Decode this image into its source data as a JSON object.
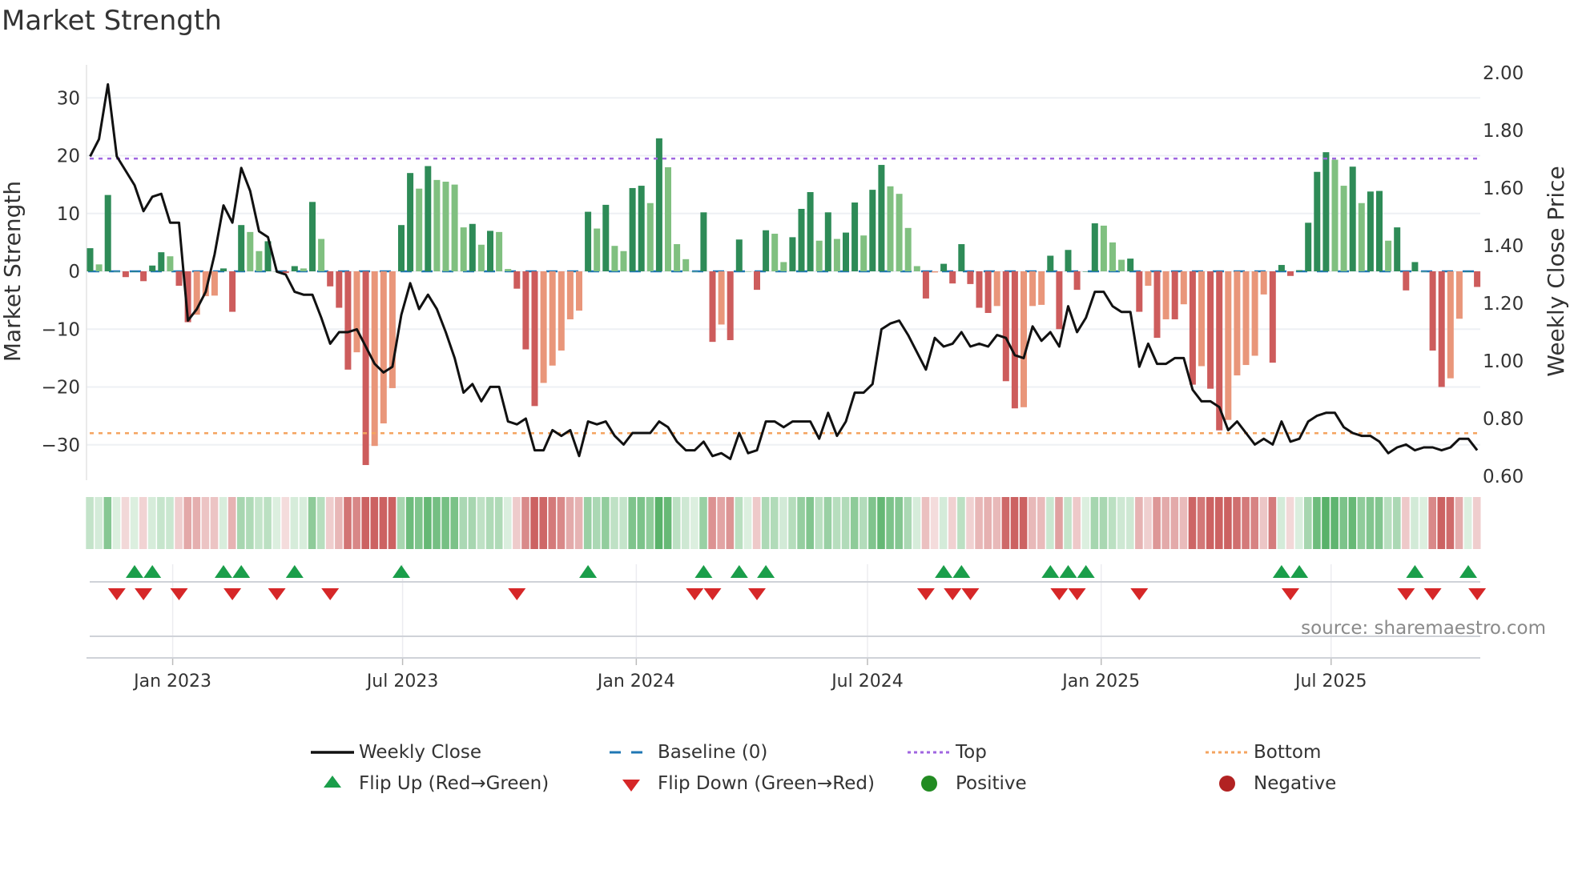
{
  "title": "Market Strength",
  "source": "source: sharemaestro.com",
  "chart_data": {
    "type": "bar+line",
    "title": "Market Strength",
    "ylabel": "Market Strength",
    "y2label": "Weekly Close Price",
    "ylim": [
      -36,
      36
    ],
    "y2lim": [
      0.586,
      2.03
    ],
    "grid": true,
    "legend_position": "bottom",
    "y_ticks": [
      {
        "value": 30,
        "label": "30"
      },
      {
        "value": 20,
        "label": "20"
      },
      {
        "value": 10,
        "label": "10"
      },
      {
        "value": 0,
        "label": "0"
      },
      {
        "value": -10,
        "label": "−10"
      },
      {
        "value": -20,
        "label": "−20"
      },
      {
        "value": -30,
        "label": "−30"
      }
    ],
    "y2_ticks": [
      {
        "value": 2.0,
        "label": "2.00"
      },
      {
        "value": 1.8,
        "label": "1.80"
      },
      {
        "value": 1.6,
        "label": "1.60"
      },
      {
        "value": 1.4,
        "label": "1.40"
      },
      {
        "value": 1.2,
        "label": "1.20"
      },
      {
        "value": 1.0,
        "label": "1.00"
      },
      {
        "value": 0.8,
        "label": "0.80"
      },
      {
        "value": 0.6,
        "label": "0.60"
      }
    ],
    "x_start": "2022-10-28",
    "x_step_days": 7,
    "x_ticks": [
      {
        "date": "2023-01-01",
        "label": "Jan 2023"
      },
      {
        "date": "2023-07-01",
        "label": "Jul 2023"
      },
      {
        "date": "2024-01-01",
        "label": "Jan 2024"
      },
      {
        "date": "2024-07-01",
        "label": "Jul 2024"
      },
      {
        "date": "2025-01-01",
        "label": "Jan 2025"
      },
      {
        "date": "2025-07-01",
        "label": "Jul 2025"
      }
    ],
    "top_level": 19.5,
    "bottom_level": -28,
    "baseline": 0,
    "strength": [
      4,
      1.2,
      13.2,
      0,
      -1,
      0,
      -1.7,
      1,
      3.3,
      2.6,
      -2.5,
      -8.8,
      -7.5,
      -4.3,
      -4.2,
      0.5,
      -7,
      8,
      6.8,
      3.5,
      5.2,
      0,
      -0.3,
      0.9,
      0.5,
      12,
      5.6,
      -2.6,
      -6.3,
      -17,
      -14,
      -33.5,
      -30.2,
      -26.3,
      -20.2,
      8,
      17,
      14.3,
      18.2,
      15.8,
      15.5,
      15,
      7.6,
      8.2,
      4.6,
      7,
      6.8,
      0.4,
      -3,
      -13.5,
      -23.3,
      -19.3,
      -16.3,
      -13.7,
      -8.3,
      -6.8,
      10.3,
      7.4,
      11.5,
      4.4,
      3.5,
      14.4,
      14.8,
      11.8,
      23,
      18,
      4.7,
      2.1,
      0,
      10.2,
      -12.2,
      -9.2,
      -11.9,
      5.5,
      0,
      -3.2,
      7.1,
      6.5,
      1.6,
      5.9,
      10.8,
      13.7,
      5.3,
      10.2,
      5.6,
      6.7,
      11.9,
      6.2,
      14.1,
      18.4,
      14.7,
      13.4,
      7.5,
      0.9,
      -4.7,
      -0.2,
      1.3,
      -2.1,
      4.7,
      -2.2,
      -6.3,
      -7.2,
      -6,
      -19,
      -23.7,
      -23.5,
      -6,
      -5.8,
      2.7,
      -10,
      3.7,
      -3.2,
      0,
      8.3,
      7.9,
      5,
      2,
      2.2,
      -7,
      -2.5,
      -11.5,
      -8.3,
      -8.3,
      -5.7,
      -19.6,
      -16.4,
      -20.3,
      -27.5,
      -25.7,
      -18,
      -16.2,
      -14.6,
      -4,
      -15.8,
      1.1,
      -0.8,
      0.2,
      8.4,
      17.2,
      20.6,
      19.3,
      14.8,
      18.1,
      11.8,
      13.8,
      13.9,
      5.3,
      7.6,
      -3.3,
      1.6,
      0,
      -13.7,
      -20,
      -18.5,
      -8.2,
      0,
      -2.7
    ],
    "weekly_close": [
      1.71,
      1.77,
      1.96,
      1.71,
      1.66,
      1.61,
      1.52,
      1.57,
      1.58,
      1.48,
      1.48,
      1.14,
      1.18,
      1.24,
      1.37,
      1.54,
      1.48,
      1.67,
      1.59,
      1.45,
      1.43,
      1.31,
      1.3,
      1.24,
      1.23,
      1.23,
      1.15,
      1.06,
      1.1,
      1.1,
      1.11,
      1.05,
      0.99,
      0.96,
      0.98,
      1.16,
      1.27,
      1.18,
      1.23,
      1.18,
      1.1,
      1.01,
      0.89,
      0.92,
      0.86,
      0.91,
      0.91,
      0.79,
      0.78,
      0.8,
      0.69,
      0.69,
      0.76,
      0.74,
      0.76,
      0.67,
      0.79,
      0.78,
      0.79,
      0.74,
      0.71,
      0.75,
      0.75,
      0.75,
      0.79,
      0.77,
      0.72,
      0.69,
      0.69,
      0.72,
      0.67,
      0.68,
      0.66,
      0.75,
      0.68,
      0.69,
      0.79,
      0.79,
      0.77,
      0.79,
      0.79,
      0.79,
      0.73,
      0.82,
      0.74,
      0.79,
      0.89,
      0.89,
      0.92,
      1.11,
      1.13,
      1.14,
      1.09,
      1.03,
      0.97,
      1.08,
      1.05,
      1.06,
      1.1,
      1.05,
      1.06,
      1.05,
      1.09,
      1.08,
      1.02,
      1.01,
      1.12,
      1.07,
      1.1,
      1.05,
      1.19,
      1.1,
      1.15,
      1.24,
      1.24,
      1.19,
      1.17,
      1.17,
      0.98,
      1.06,
      0.99,
      0.99,
      1.01,
      1.01,
      0.9,
      0.86,
      0.86,
      0.84,
      0.76,
      0.79,
      0.75,
      0.71,
      0.73,
      0.71,
      0.79,
      0.72,
      0.73,
      0.79,
      0.81,
      0.82,
      0.82,
      0.77,
      0.75,
      0.74,
      0.74,
      0.72,
      0.68,
      0.7,
      0.71,
      0.69,
      0.7,
      0.7,
      0.69,
      0.7,
      0.73,
      0.73,
      0.69
    ],
    "flip_up_weeks": [
      5,
      7,
      15,
      17,
      23,
      35,
      56,
      69,
      73,
      76,
      96,
      98,
      108,
      110,
      112,
      134,
      136,
      149,
      155
    ],
    "flip_down_weeks": [
      3,
      6,
      10,
      16,
      21,
      27,
      48,
      68,
      70,
      75,
      94,
      97,
      99,
      109,
      111,
      118,
      135,
      148,
      151,
      156
    ],
    "legend": [
      {
        "label": "Weekly Close",
        "symbol": "solid-line",
        "color": "#111111"
      },
      {
        "label": "Baseline (0)",
        "symbol": "dashed-line",
        "color": "#1f77b4"
      },
      {
        "label": "Top",
        "symbol": "dotted-line",
        "color": "#a066e0"
      },
      {
        "label": "Bottom",
        "symbol": "dotted-line",
        "color": "#f4a460"
      },
      {
        "label": "Flip Up (Red→Green)",
        "symbol": "triangle-up",
        "color": "#1a9e4a"
      },
      {
        "label": "Flip Down (Green→Red)",
        "symbol": "triangle-down",
        "color": "#d62728"
      },
      {
        "label": "Positive",
        "symbol": "circle",
        "color": "#228b22"
      },
      {
        "label": "Negative",
        "symbol": "circle",
        "color": "#b22222"
      }
    ],
    "colors": {
      "pos_strong": "#2e8b57",
      "pos_weak": "#80c080",
      "neg_strong": "#cd5c5c",
      "neg_weak": "#e9967a",
      "grid": "#eef0f4"
    }
  }
}
